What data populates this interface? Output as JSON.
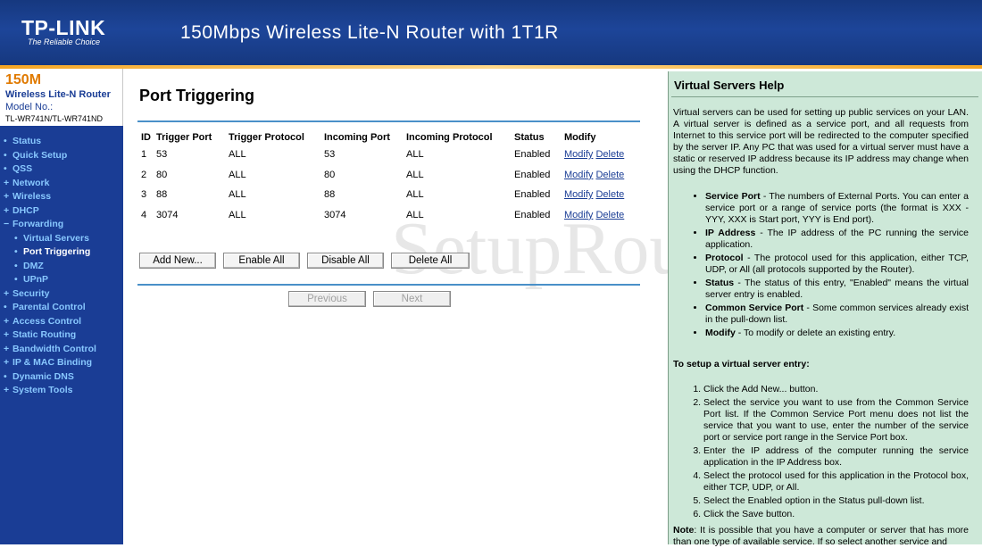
{
  "header": {
    "logo": "TP-LINK",
    "logo_tagline": "The Reliable Choice",
    "title": "150Mbps Wireless Lite-N Router with 1T1R"
  },
  "model": {
    "big": "150M",
    "line": "Wireless Lite-N Router",
    "label": "Model No.:",
    "id": "TL-WR741N/TL-WR741ND"
  },
  "nav": {
    "items": [
      {
        "label": "Status",
        "bullet": "•"
      },
      {
        "label": "Quick Setup",
        "bullet": "•"
      },
      {
        "label": "QSS",
        "bullet": "•"
      },
      {
        "label": "Network",
        "bullet": "+"
      },
      {
        "label": "Wireless",
        "bullet": "+"
      },
      {
        "label": "DHCP",
        "bullet": "+"
      },
      {
        "label": "Forwarding",
        "bullet": "−"
      }
    ],
    "forwarding_sub": [
      {
        "label": "Virtual Servers",
        "bullet": "•"
      },
      {
        "label": "Port Triggering",
        "bullet": "•"
      },
      {
        "label": "DMZ",
        "bullet": "•"
      },
      {
        "label": "UPnP",
        "bullet": "•"
      }
    ],
    "items_after": [
      {
        "label": "Security",
        "bullet": "+"
      },
      {
        "label": "Parental Control",
        "bullet": "•"
      },
      {
        "label": "Access Control",
        "bullet": "+"
      },
      {
        "label": "Static Routing",
        "bullet": "+"
      },
      {
        "label": "Bandwidth Control",
        "bullet": "+"
      },
      {
        "label": "IP & MAC Binding",
        "bullet": "+"
      },
      {
        "label": "Dynamic DNS",
        "bullet": "•"
      },
      {
        "label": "System Tools",
        "bullet": "+"
      }
    ]
  },
  "page": {
    "title": "Port Triggering",
    "columns": [
      "ID",
      "Trigger Port",
      "Trigger Protocol",
      "Incoming Port",
      "Incoming Protocol",
      "Status",
      "Modify"
    ],
    "rows": [
      {
        "id": "1",
        "trigger_port": "53",
        "trigger_protocol": "ALL",
        "incoming_port": "53",
        "incoming_protocol": "ALL",
        "status": "Enabled"
      },
      {
        "id": "2",
        "trigger_port": "80",
        "trigger_protocol": "ALL",
        "incoming_port": "80",
        "incoming_protocol": "ALL",
        "status": "Enabled"
      },
      {
        "id": "3",
        "trigger_port": "88",
        "trigger_protocol": "ALL",
        "incoming_port": "88",
        "incoming_protocol": "ALL",
        "status": "Enabled"
      },
      {
        "id": "4",
        "trigger_port": "3074",
        "trigger_protocol": "ALL",
        "incoming_port": "3074",
        "incoming_protocol": "ALL",
        "status": "Enabled"
      }
    ],
    "modify_label": "Modify",
    "delete_label": "Delete",
    "buttons": {
      "add_new": "Add New...",
      "enable_all": "Enable All",
      "disable_all": "Disable All",
      "delete_all": "Delete All",
      "previous": "Previous",
      "next": "Next"
    }
  },
  "help": {
    "title": "Virtual Servers Help",
    "intro": "Virtual servers can be used for setting up public services on your LAN. A virtual server is defined as a service port, and all requests from Internet to this service port will be redirected to the computer specified by the server IP. Any PC that was used for a virtual server must have a static or reserved IP address because its IP address may change when using the DHCP function.",
    "bullets": [
      {
        "term": "Service Port",
        "text": " - The numbers of External Ports. You can enter a service port or a range of service ports (the format is XXX - YYY, XXX is Start port, YYY is End port)."
      },
      {
        "term": "IP Address",
        "text": " - The IP address of the PC running the service application."
      },
      {
        "term": "Protocol",
        "text": " - The protocol used for this application, either TCP, UDP, or All (all protocols supported by the Router)."
      },
      {
        "term": "Status",
        "text": " - The status of this entry, \"Enabled\" means the virtual server entry is enabled."
      },
      {
        "term": "Common Service Port",
        "text": " - Some common services already exist in the pull-down list."
      },
      {
        "term": "Modify",
        "text": " - To modify or delete an existing entry."
      }
    ],
    "setup_heading": "To setup a virtual server entry:",
    "steps": [
      "Click the Add New... button.",
      "Select the service you want to use from the Common Service Port list. If the Common Service Port menu does not list the service that you want to use, enter the number of the service port or service port range in the Service Port box.",
      "Enter the IP address of the computer running the service application in the IP Address box.",
      "Select the protocol used for this application in the Protocol box, either TCP, UDP, or All.",
      "Select the Enabled option in the Status pull-down list.",
      "Click the Save button."
    ],
    "note_label": "Note",
    "note": ": It is possible that you have a computer or server that has more than one type of available service. If so select another service and"
  },
  "watermark": "SetupRouter"
}
